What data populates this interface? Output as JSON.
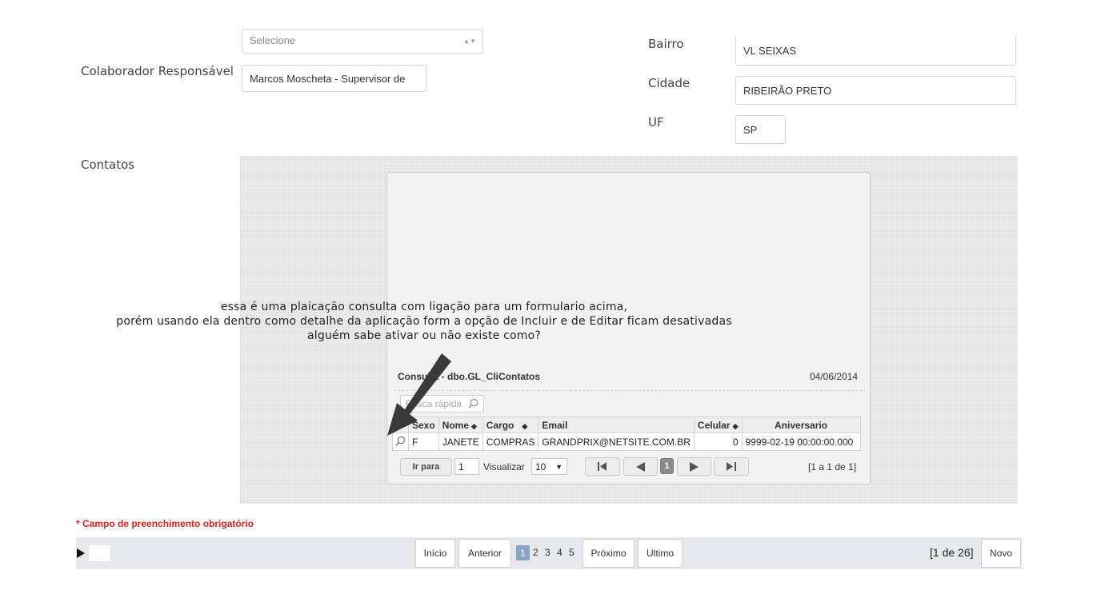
{
  "form": {
    "top_select_value": "Selecione",
    "colaborador_label": "Colaborador Responsável",
    "colaborador_value": "Marcos Moscheta - Supervisor de",
    "bairro_label": "Bairro",
    "bairro_value": "VL SEIXAS",
    "cidade_label": "Cidade",
    "cidade_value": "RIBEIRÃO PRETO",
    "uf_label": "UF",
    "uf_value": "SP",
    "contatos_label": "Contatos"
  },
  "annotation": {
    "line1": "essa é uma plaicação consulta com ligação para um formulario acima,",
    "line2": "porém usando ela dentro como detalhe da aplicação form a opção de Incluir e de Editar ficam desativadas",
    "line3": "alguém sabe ativar ou não existe como?"
  },
  "grid": {
    "title": "Consulta - dbo.GL_CliContatos",
    "date": "04/06/2014",
    "quick_search_placeholder": "Busca rápida",
    "columns": [
      "Sexo",
      "Nome",
      "Cargo",
      "Email",
      "Celular",
      "Aniversario"
    ],
    "rows": [
      {
        "sexo": "F",
        "nome": "JANETE",
        "cargo": "COMPRAS",
        "email": "GRANDPRIX@NETSITE.COM.BR",
        "celular": "0",
        "aniversario": "9999-02-19 00:00:00.000"
      }
    ],
    "nav": {
      "ir_para_label": "Ir para",
      "ir_para_value": "1",
      "visualizar_label": "Visualizar",
      "visualizar_value": "10",
      "current_page": "1",
      "summary": "[1 a 1 de 1]"
    }
  },
  "footer": {
    "required_note": "* Campo de preenchimento obrigatório",
    "inicio_label": "Início",
    "anterior_label": "Anterior",
    "pages": [
      "1",
      "2",
      "3",
      "4",
      "5"
    ],
    "proximo_label": "Próximo",
    "ultimo_label": "Ultimo",
    "summary": "[1 de 26]",
    "novo_label": "Novo"
  },
  "colors": {
    "required_red": "#e0201a",
    "active_page": "#8aa4c4"
  }
}
